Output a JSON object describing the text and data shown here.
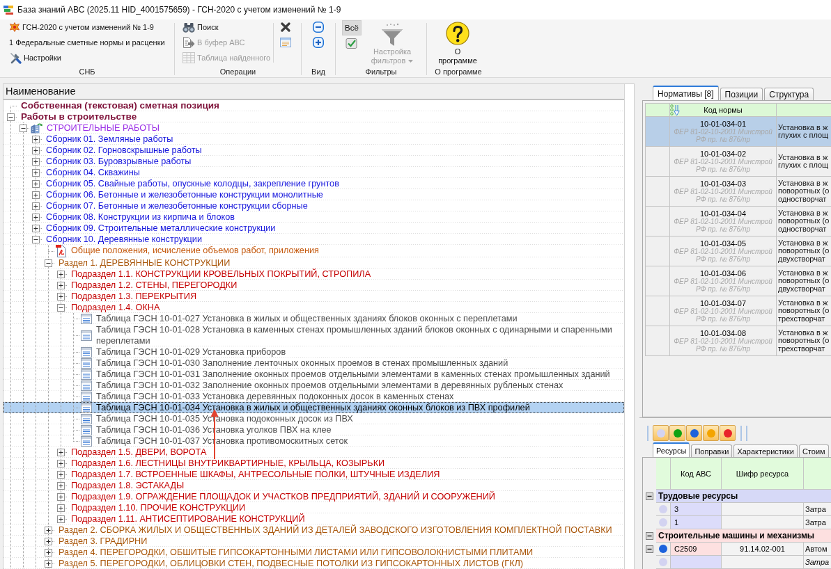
{
  "window": {
    "title": "База знаний АВС (2025.11 HID_4001575659) - ГСН-2020 с учетом изменений № 1-9"
  },
  "ribbon": {
    "snb": {
      "label": "СНБ",
      "norm_base": "ГСН-2020 с учетом изменений № 1-9",
      "norm_set": "1 Федеральные сметные нормы и расценки",
      "settings": "Настройки"
    },
    "operations": {
      "label": "Операции",
      "buttons": [
        {
          "label": "Поиск",
          "disabled": false
        },
        {
          "label": "В буфер АВС",
          "disabled": true
        },
        {
          "label": "Таблица найденного",
          "disabled": true
        }
      ]
    },
    "view": {
      "label": "Вид"
    },
    "filters": {
      "label": "Фильтры",
      "all_toggle": {
        "label": "Всё",
        "on": true
      },
      "settings": {
        "label": "Настройка фильтров",
        "disabled": true
      }
    },
    "about": {
      "label": "О программе",
      "button": "О программе"
    }
  },
  "tree": {
    "header": "Наименование",
    "annotation": {
      "kind": "arrow"
    },
    "nodes": [
      {
        "kind": "root",
        "label": "Собственная (текстовая) сметная позиция",
        "selected": false
      },
      {
        "kind": "root",
        "label": "Работы в строительстве",
        "expanded": true,
        "selected": false,
        "children": [
          {
            "kind": "category",
            "label": "СТРОИТЕЛЬНЫЕ РАБОТЫ",
            "expanded": true,
            "selected": false,
            "children": [
              {
                "kind": "collection",
                "label": "Сборник 01. Земляные работы",
                "expanded": false,
                "selected": false
              },
              {
                "kind": "collection",
                "label": "Сборник 02. Горновскрышные работы",
                "expanded": false,
                "selected": false
              },
              {
                "kind": "collection",
                "label": "Сборник 03. Буровзрывные работы",
                "expanded": false,
                "selected": false
              },
              {
                "kind": "collection",
                "label": "Сборник 04. Скважины",
                "expanded": false,
                "selected": false
              },
              {
                "kind": "collection",
                "label": "Сборник 05. Свайные работы, опускные колодцы, закрепление грунтов",
                "expanded": false,
                "selected": false
              },
              {
                "kind": "collection",
                "label": "Сборник 06. Бетонные и железобетонные конструкции монолитные",
                "expanded": false,
                "selected": false
              },
              {
                "kind": "collection",
                "label": "Сборник 07. Бетонные и железобетонные конструкции сборные",
                "expanded": false,
                "selected": false
              },
              {
                "kind": "collection",
                "label": "Сборник 08. Конструкции из кирпича и блоков",
                "expanded": false,
                "selected": false
              },
              {
                "kind": "collection",
                "label": "Сборник 09. Строительные металлические конструкции",
                "expanded": false,
                "selected": false
              },
              {
                "kind": "collection",
                "label": "Сборник 10. Деревянные конструкции",
                "expanded": true,
                "selected": false,
                "children": [
                  {
                    "kind": "document",
                    "label": "Общие положения, исчисление объемов работ, приложения",
                    "selected": false
                  },
                  {
                    "kind": "section",
                    "label": "Раздел 1. ДЕРЕВЯННЫЕ КОНСТРУКЦИИ",
                    "expanded": true,
                    "selected": false,
                    "children": [
                      {
                        "kind": "subsection",
                        "label": "Подраздел 1.1. КОНСТРУКЦИИ КРОВЕЛЬНЫХ ПОКРЫТИЙ, СТРОПИЛА",
                        "expanded": false,
                        "selected": false
                      },
                      {
                        "kind": "subsection",
                        "label": "Подраздел 1.2. СТЕНЫ, ПЕРЕГОРОДКИ",
                        "expanded": false,
                        "selected": false
                      },
                      {
                        "kind": "subsection",
                        "label": "Подраздел 1.3. ПЕРЕКРЫТИЯ",
                        "expanded": false,
                        "selected": false
                      },
                      {
                        "kind": "subsection",
                        "label": "Подраздел 1.4. ОКНА",
                        "expanded": true,
                        "selected": false,
                        "children": [
                          {
                            "kind": "table",
                            "label": "Таблица ГЭСН 10-01-027 Установка в жилых и общественных зданиях блоков оконных с переплетами",
                            "selected": false
                          },
                          {
                            "kind": "table",
                            "label": "Таблица ГЭСН 10-01-028 Установка в каменных стенах промышленных зданий блоков оконных с одинарными и спаренными переплетами",
                            "selected": false
                          },
                          {
                            "kind": "table",
                            "label": "Таблица ГЭСН 10-01-029 Установка приборов",
                            "selected": false
                          },
                          {
                            "kind": "table",
                            "label": "Таблица ГЭСН 10-01-030 Заполнение ленточных оконных проемов в стенах промышленных зданий",
                            "selected": false
                          },
                          {
                            "kind": "table",
                            "label": "Таблица ГЭСН 10-01-031 Заполнение оконных проемов отдельными элементами в каменных стенах промышленных зданий",
                            "selected": false
                          },
                          {
                            "kind": "table",
                            "label": "Таблица ГЭСН 10-01-032 Заполнение оконных проемов отдельными элементами в деревянных рубленых стенах",
                            "selected": false
                          },
                          {
                            "kind": "table",
                            "label": "Таблица ГЭСН 10-01-033 Установка деревянных подоконных досок в каменных стенах",
                            "selected": false
                          },
                          {
                            "kind": "table",
                            "label": "Таблица ГЭСН 10-01-034 Установка в жилых и общественных зданиях оконных блоков из ПВХ профилей",
                            "selected": true
                          },
                          {
                            "kind": "table",
                            "label": "Таблица ГЭСН 10-01-035 Установка подоконных досок из ПВХ",
                            "selected": false
                          },
                          {
                            "kind": "table",
                            "label": "Таблица ГЭСН 10-01-036 Установка уголков ПВХ на клее",
                            "selected": false
                          },
                          {
                            "kind": "table",
                            "label": "Таблица ГЭСН 10-01-037 Установка противомоскитных сеток",
                            "selected": false
                          }
                        ]
                      },
                      {
                        "kind": "subsection",
                        "label": "Подраздел 1.5. ДВЕРИ, ВОРОТА",
                        "expanded": false,
                        "selected": false
                      },
                      {
                        "kind": "subsection",
                        "label": "Подраздел 1.6. ЛЕСТНИЦЫ ВНУТРИКВАРТИРНЫЕ, КРЫЛЬЦА, КОЗЫРЬКИ",
                        "expanded": false,
                        "selected": false
                      },
                      {
                        "kind": "subsection",
                        "label": "Подраздел 1.7. ВСТРОЕННЫЕ ШКАФЫ, АНТРЕСОЛЬНЫЕ ПОЛКИ, ШТУЧНЫЕ ИЗДЕЛИЯ",
                        "expanded": false,
                        "selected": false
                      },
                      {
                        "kind": "subsection",
                        "label": "Подраздел 1.8. ЭСТАКАДЫ",
                        "expanded": false,
                        "selected": false
                      },
                      {
                        "kind": "subsection",
                        "label": "Подраздел 1.9. ОГРАЖДЕНИЕ ПЛОЩАДОК И УЧАСТКОВ ПРЕДПРИЯТИЙ, ЗДАНИЙ И СООРУЖЕНИЙ",
                        "expanded": false,
                        "selected": false
                      },
                      {
                        "kind": "subsection",
                        "label": "Подраздел 1.10. ПРОЧИЕ КОНСТРУКЦИИ",
                        "expanded": false,
                        "selected": false
                      },
                      {
                        "kind": "subsection",
                        "label": "Подраздел 1.11. АНТИСЕПТИРОВАНИЕ КОНСТРУКЦИЙ",
                        "expanded": false,
                        "selected": false
                      }
                    ]
                  },
                  {
                    "kind": "section",
                    "label": "Раздел 2. СБОРКА ЖИЛЫХ И ОБЩЕСТВЕННЫХ ЗДАНИЙ ИЗ ДЕТАЛЕЙ ЗАВОДСКОГО ИЗГОТОВЛЕНИЯ КОМПЛЕКТНОЙ ПОСТАВКИ",
                    "expanded": false,
                    "selected": false
                  },
                  {
                    "kind": "section",
                    "label": "Раздел 3. ГРАДИРНИ",
                    "expanded": false,
                    "selected": false
                  },
                  {
                    "kind": "section",
                    "label": "Раздел 4. ПЕРЕГОРОДКИ, ОБШИТЫЕ ГИПСОКАРТОННЫМИ ЛИСТАМИ ИЛИ ГИПСОВОЛОКНИСТЫМИ ПЛИТАМИ",
                    "expanded": false,
                    "selected": false
                  },
                  {
                    "kind": "section",
                    "label": "Раздел 5. ПЕРЕГОРОДКИ, ОБЛИЦОВКИ СТЕН, ПОДВЕСНЫЕ ПОТОЛКИ ИЗ ГИПСОКАРТОННЫХ ЛИСТОВ (ГКЛ)",
                    "expanded": false,
                    "selected": false
                  }
                ]
              }
            ]
          }
        ]
      }
    ]
  },
  "norms_panel": {
    "tabs": [
      {
        "label": "Нормативы [8]",
        "selected": true
      },
      {
        "label": "Позиции",
        "selected": false
      },
      {
        "label": "Структура",
        "selected": false
      }
    ],
    "columns": [
      "Код нормы"
    ],
    "rows": [
      {
        "code": "10-01-034-01",
        "source": "ФЕР 81-02-10-2001 Минстрой РФ пр. № 876/пр",
        "description_lines": [
          "Установка в ж",
          "глухих с площ"
        ],
        "selected": true
      },
      {
        "code": "10-01-034-02",
        "source": "ФЕР 81-02-10-2001 Минстрой РФ пр. № 876/пр",
        "description_lines": [
          "Установка в ж",
          "глухих с площ"
        ],
        "selected": false
      },
      {
        "code": "10-01-034-03",
        "source": "ФЕР 81-02-10-2001 Минстрой РФ пр. № 876/пр",
        "description_lines": [
          "Установка в ж",
          "поворотных (о",
          "одностворчат"
        ],
        "selected": false
      },
      {
        "code": "10-01-034-04",
        "source": "ФЕР 81-02-10-2001 Минстрой РФ пр. № 876/пр",
        "description_lines": [
          "Установка в ж",
          "поворотных (о",
          "одностворчат"
        ],
        "selected": false
      },
      {
        "code": "10-01-034-05",
        "source": "ФЕР 81-02-10-2001 Минстрой РФ пр. № 876/пр",
        "description_lines": [
          "Установка в ж",
          "поворотных (о",
          "двухстворчат"
        ],
        "selected": false
      },
      {
        "code": "10-01-034-06",
        "source": "ФЕР 81-02-10-2001 Минстрой РФ пр. № 876/пр",
        "description_lines": [
          "Установка в ж",
          "поворотных (о",
          "двухстворчат"
        ],
        "selected": false
      },
      {
        "code": "10-01-034-07",
        "source": "ФЕР 81-02-10-2001 Минстрой РФ пр. № 876/пр",
        "description_lines": [
          "Установка в ж",
          "поворотных (о",
          "трехстворчат"
        ],
        "selected": false
      },
      {
        "code": "10-01-034-08",
        "source": "ФЕР 81-02-10-2001 Минстрой РФ пр. № 876/пр",
        "description_lines": [
          "Установка в ж",
          "поворотных (о",
          "трехстворчат"
        ],
        "selected": false
      }
    ]
  },
  "resources_panel": {
    "filter_buttons": [
      {
        "color": "#d3d3f1",
        "on": true
      },
      {
        "color": "#12a212",
        "on": true
      },
      {
        "color": "#1d62dc",
        "on": true
      },
      {
        "color": "#f4a400",
        "on": true
      },
      {
        "color": "#e8242a",
        "on": true
      }
    ],
    "tabs": [
      {
        "label": "Ресурсы",
        "selected": true
      },
      {
        "label": "Поправки",
        "selected": false
      },
      {
        "label": "Характеристики",
        "selected": false
      },
      {
        "label": "Стоим",
        "selected": false
      }
    ],
    "columns": [
      "Код АВС",
      "Шифр ресурса"
    ],
    "rows": [
      {
        "kind": "group",
        "label": "Трудовые ресурсы",
        "color": "#d6d9f7",
        "expanded": true,
        "children": [
          {
            "kind": "labor",
            "code": "3",
            "name": "Затра",
            "color": "#d3d3f1"
          },
          {
            "kind": "labor",
            "code": "1",
            "name": "Затра",
            "color": "#d3d3f1"
          }
        ]
      },
      {
        "kind": "group",
        "label": "Строительные машины и механизмы",
        "color": "#fde0e0",
        "expanded": true,
        "children": [
          {
            "kind": "machine",
            "code": "С2509",
            "cipher": "91.14.02-001",
            "name": "Автом",
            "color": "#1d62dc",
            "expanded": true,
            "children": [
              {
                "kind": "labor",
                "name": "Затра",
                "color": "#d3d3f1"
              }
            ]
          }
        ]
      }
    ]
  }
}
